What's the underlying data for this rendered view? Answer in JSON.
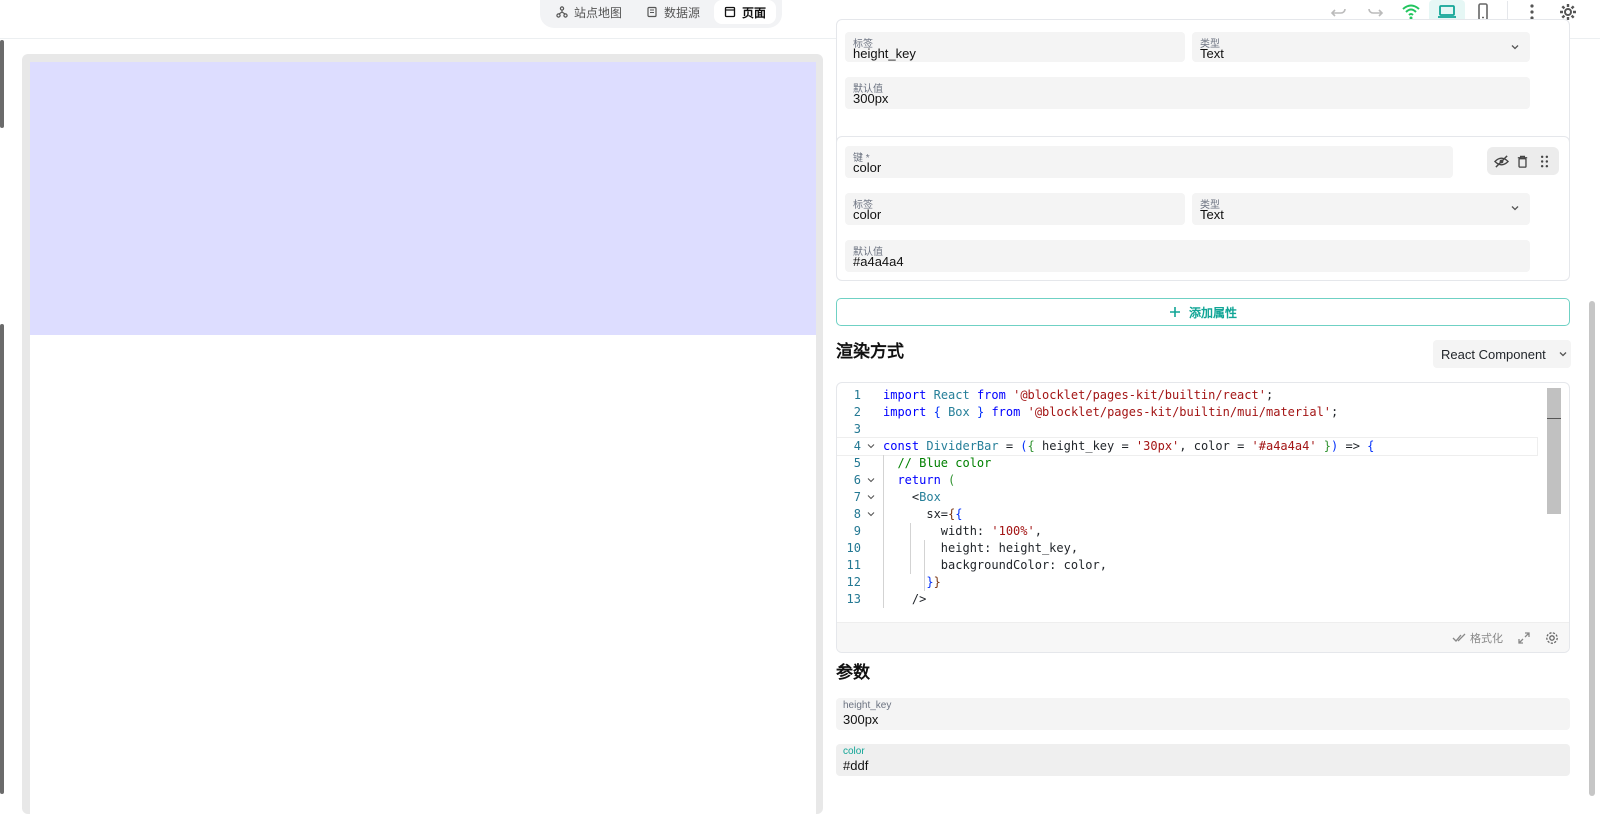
{
  "top_tabs": [
    {
      "label": "站点地图",
      "icon": "sitemap-icon",
      "active": false
    },
    {
      "label": "数据源",
      "icon": "datasource-icon",
      "active": false
    },
    {
      "label": "页面",
      "icon": "page-icon",
      "active": true
    }
  ],
  "toolbar": {
    "undo": "undo-icon",
    "redo": "redo-icon",
    "status": "wifi-icon",
    "status_color": "#22c55e",
    "desktop": "laptop-icon",
    "mobile": "phone-icon",
    "more": "more-vert-icon",
    "settings": "gear-icon",
    "accent": "#11a596"
  },
  "preview": {
    "bar_color": "#ddddff"
  },
  "properties": {
    "prop1": {
      "label_field": {
        "label": "标签",
        "value": "height_key"
      },
      "type_field": {
        "label": "类型",
        "value": "Text"
      },
      "default_field": {
        "label": "默认值",
        "value": "300px"
      }
    },
    "prop2": {
      "key_field": {
        "label": "键 *",
        "value": "color"
      },
      "label_field": {
        "label": "标签",
        "value": "color"
      },
      "type_field": {
        "label": "类型",
        "value": "Text"
      },
      "default_field": {
        "label": "默认值",
        "value": "#a4a4a4"
      }
    },
    "add_label": "添加属性"
  },
  "render": {
    "title": "渲染方式",
    "mode": "React Component"
  },
  "code_lines": [
    {
      "n": "1",
      "fold": false
    },
    {
      "n": "2",
      "fold": false
    },
    {
      "n": "3",
      "fold": false
    },
    {
      "n": "4",
      "fold": true
    },
    {
      "n": "5",
      "fold": false
    },
    {
      "n": "6",
      "fold": true
    },
    {
      "n": "7",
      "fold": true
    },
    {
      "n": "8",
      "fold": true
    },
    {
      "n": "9",
      "fold": false
    },
    {
      "n": "10",
      "fold": false
    },
    {
      "n": "11",
      "fold": false
    },
    {
      "n": "12",
      "fold": false
    },
    {
      "n": "13",
      "fold": false
    }
  ],
  "code": {
    "l1": [
      "import",
      "React",
      "from",
      "'@blocklet/pages-kit/builtin/react'",
      ";"
    ],
    "l2": [
      "import",
      "{",
      "Box",
      "}",
      "from",
      "'@blocklet/pages-kit/builtin/mui/material'",
      ";"
    ],
    "l4": [
      "const",
      "DividerBar",
      " = ",
      "(",
      "{",
      " height_key = ",
      "'30px'",
      ", color = ",
      "'#a4a4a4'",
      " }",
      ")",
      " => ",
      "{"
    ],
    "l5": "// Blue color",
    "l6": [
      "return",
      "("
    ],
    "l7": [
      "<",
      "Box"
    ],
    "l8": [
      "sx=",
      "{",
      "{"
    ],
    "l9": [
      "width: ",
      "'100%'",
      ","
    ],
    "l10": "height: height_key,",
    "l11": "backgroundColor: color,",
    "l12": [
      "}",
      "}"
    ],
    "l13": "/>"
  },
  "editor_footer": {
    "format": "格式化"
  },
  "params": {
    "title": "参数",
    "items": [
      {
        "label": "height_key",
        "value": "300px"
      },
      {
        "label": "color",
        "value": "#ddf"
      }
    ]
  }
}
